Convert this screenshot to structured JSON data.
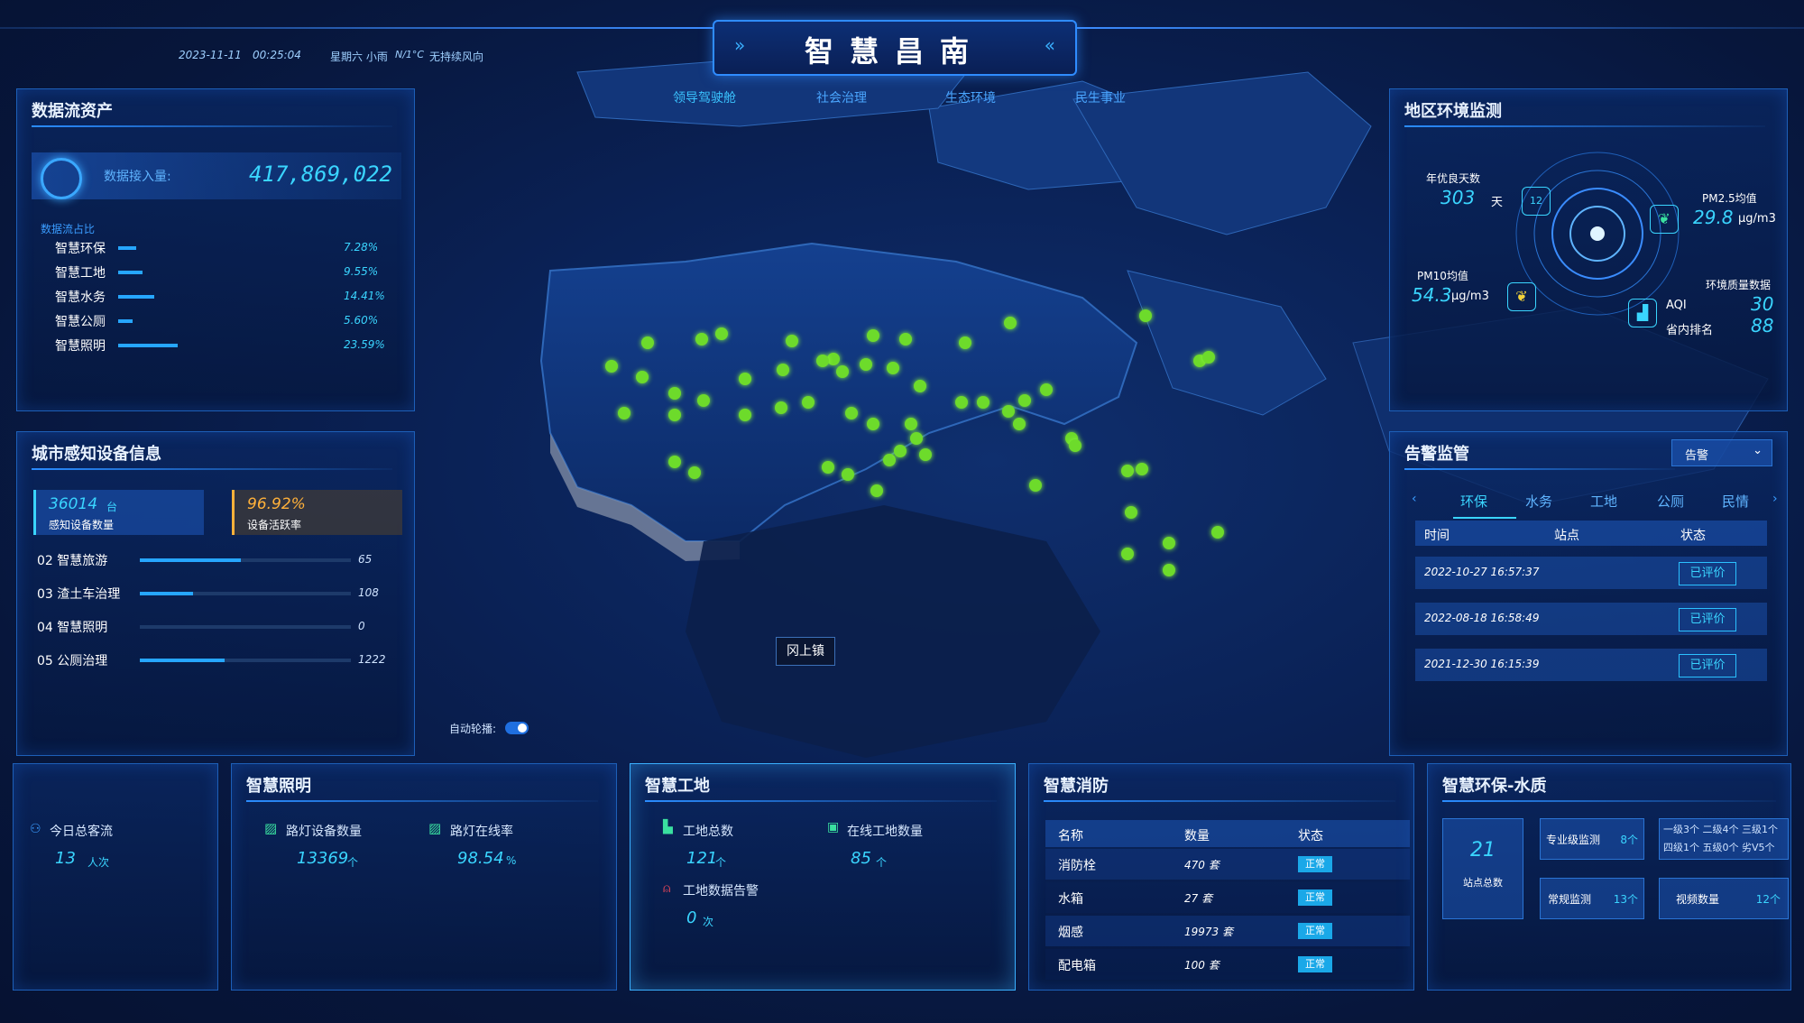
{
  "header": {
    "title": "智慧昌南",
    "date": "2023-11-11",
    "time": "00:25:04",
    "weather": "星期六 小雨",
    "temp": "N/1°C",
    "wind": "无持续风向",
    "nav": [
      "领导驾驶舱",
      "社会治理",
      "生态环境",
      "民生事业"
    ]
  },
  "data_assets": {
    "title": "数据流资产",
    "intake_label": "数据接入量:",
    "intake_value": "417,869,022",
    "ratio_label": "数据流占比",
    "rows": [
      {
        "name": "智慧环保",
        "pct": "7.28%",
        "v": 7.28
      },
      {
        "name": "智慧工地",
        "pct": "9.55%",
        "v": 9.55
      },
      {
        "name": "智慧水务",
        "pct": "14.41%",
        "v": 14.41
      },
      {
        "name": "智慧公厕",
        "pct": "5.60%",
        "v": 5.6
      },
      {
        "name": "智慧照明",
        "pct": "23.59%",
        "v": 23.59
      }
    ]
  },
  "devices": {
    "title": "城市感知设备信息",
    "count_value": "36014",
    "count_unit": "台",
    "count_label": "感知设备数量",
    "active_value": "96.92%",
    "active_label": "设备活跃率",
    "rows": [
      {
        "name": "02 智慧旅游",
        "value": "65",
        "v": 0.48
      },
      {
        "name": "03 渣土车治理",
        "value": "108",
        "v": 0.25
      },
      {
        "name": "04 智慧照明",
        "value": "0",
        "v": 0
      },
      {
        "name": "05 公厕治理",
        "value": "1222",
        "v": 0.4
      }
    ]
  },
  "env": {
    "title": "地区环境监测",
    "good_days_label": "年优良天数",
    "good_days_value": "303",
    "good_days_unit": "天",
    "good_days_badge": "12",
    "pm25_label": "PM2.5均值",
    "pm25_value": "29.8",
    "pm25_unit": "μg/m3",
    "pm10_label": "PM10均值",
    "pm10_value": "54.3",
    "pm10_unit": "μg/m3",
    "quality_label": "环境质量数据",
    "aqi_label": "AQI",
    "aqi_value": "30",
    "rank_label": "省内排名",
    "rank_value": "88"
  },
  "alarm": {
    "title": "告警监管",
    "select_value": "告警",
    "tabs": [
      "环保",
      "水务",
      "工地",
      "公厕",
      "民情"
    ],
    "cols": [
      "时间",
      "站点",
      "状态"
    ],
    "rows": [
      {
        "time": "2022-10-27 16:57:37",
        "status": "已评价"
      },
      {
        "time": "2022-08-18 16:58:49",
        "status": "已评价"
      },
      {
        "time": "2021-12-30 16:15:39",
        "status": "已评价"
      }
    ]
  },
  "map": {
    "tooltip": "冈上镇",
    "auto_label": "自动轮播:"
  },
  "flow": {
    "label": "今日总客流",
    "value": "13",
    "unit": "人次"
  },
  "lighting": {
    "title": "智慧照明",
    "dev_label": "路灯设备数量",
    "dev_value": "13369",
    "dev_unit": "个",
    "online_label": "路灯在线率",
    "online_value": "98.54",
    "online_unit": "%"
  },
  "site": {
    "title": "智慧工地",
    "total_label": "工地总数",
    "total_value": "121",
    "total_unit": "个",
    "online_label": "在线工地数量",
    "online_value": "85",
    "online_unit": "个",
    "alarm_label": "工地数据告警",
    "alarm_value": "0",
    "alarm_unit": "次"
  },
  "fire": {
    "title": "智慧消防",
    "cols": [
      "名称",
      "数量",
      "状态"
    ],
    "rows": [
      {
        "name": "消防栓",
        "count": "470 套",
        "status": "正常"
      },
      {
        "name": "水箱",
        "count": "27 套",
        "status": "正常"
      },
      {
        "name": "烟感",
        "count": "19973 套",
        "status": "正常"
      },
      {
        "name": "配电箱",
        "count": "100 套",
        "status": "正常"
      }
    ]
  },
  "water": {
    "title": "智慧环保-水质",
    "stations_value": "21",
    "stations_label": "站点总数",
    "pro_label": "专业级监测",
    "pro_value": "8个",
    "normal_label": "常规监测",
    "normal_value": "13个",
    "video_label": "视频数量",
    "video_value": "12个",
    "grade_line1": "一级3个 二级4个 三级1个",
    "grade_line2": "四级1个 五级0个 劣V5个"
  }
}
